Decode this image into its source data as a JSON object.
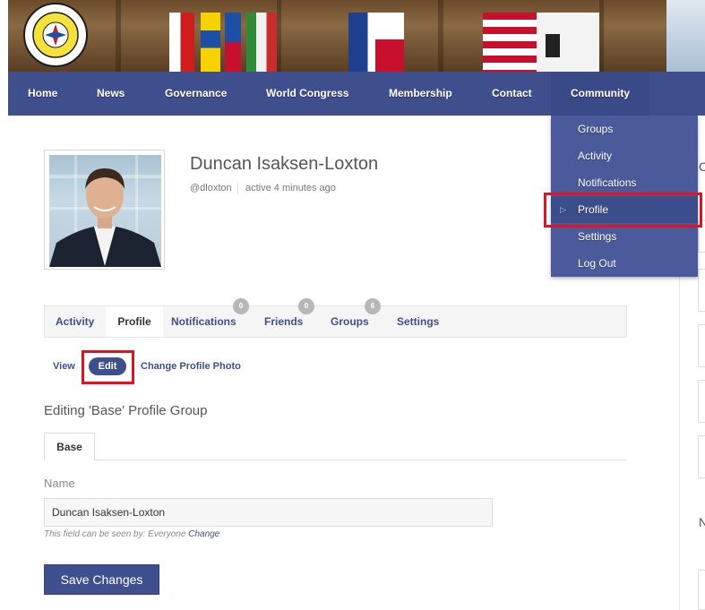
{
  "nav": {
    "items": [
      "Home",
      "News",
      "Governance",
      "World Congress",
      "Membership",
      "Contact",
      "Community"
    ]
  },
  "community_menu": {
    "items": [
      "Groups",
      "Activity",
      "Notifications",
      "Profile",
      "Settings",
      "Log Out"
    ]
  },
  "profile": {
    "name": "Duncan Isaksen-Loxton",
    "username": "@dloxton",
    "last_active": "active 4 minutes ago"
  },
  "tabs": {
    "items": [
      "Activity",
      "Profile",
      "Notifications",
      "Friends",
      "Groups",
      "Settings"
    ],
    "counts": {
      "notifications": "0",
      "friends": "0",
      "groups": "6"
    }
  },
  "subnav": {
    "view": "View",
    "edit": "Edit",
    "change_photo": "Change Profile Photo"
  },
  "form": {
    "heading": "Editing 'Base' Profile Group",
    "group_tab": "Base",
    "field_label": "Name",
    "field_value": "Duncan Isaksen-Loxton",
    "visibility_text": "This field can be seen by: Everyone",
    "visibility_change": "Change",
    "save_label": "Save Changes"
  },
  "sidebar": {
    "frag_1": "C",
    "frag_2": "I",
    "frag_3": "N"
  },
  "colors": {
    "brand": "#3f4f8e",
    "highlight": "#e8111b"
  }
}
